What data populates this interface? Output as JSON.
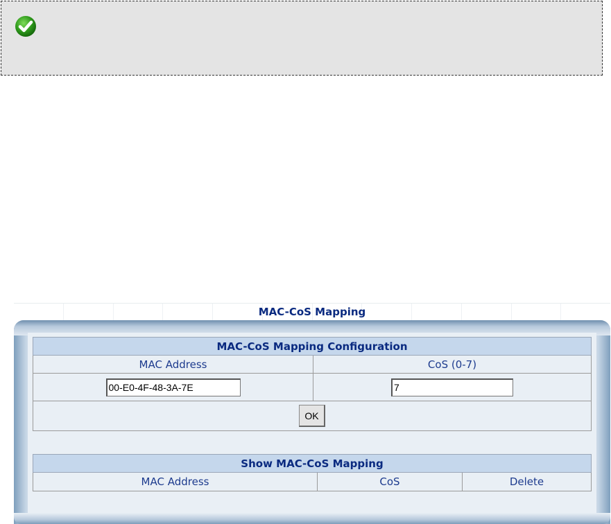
{
  "notice": {
    "icon": "check-circle-icon"
  },
  "panel": {
    "title": "MAC-CoS Mapping"
  },
  "config": {
    "header": "MAC-CoS Mapping Configuration",
    "col_mac": "MAC Address",
    "col_cos": "CoS (0-7)",
    "mac_value": "00-E0-4F-48-3A-7E",
    "cos_value": "7",
    "ok_label": "OK"
  },
  "show": {
    "header": "Show MAC-CoS Mapping",
    "col_mac": "MAC Address",
    "col_cos": "CoS",
    "col_delete": "Delete"
  },
  "colors": {
    "header_bg": "#c5d7ec",
    "title_text": "#0a2a80",
    "body_text": "#1d3b8e"
  }
}
